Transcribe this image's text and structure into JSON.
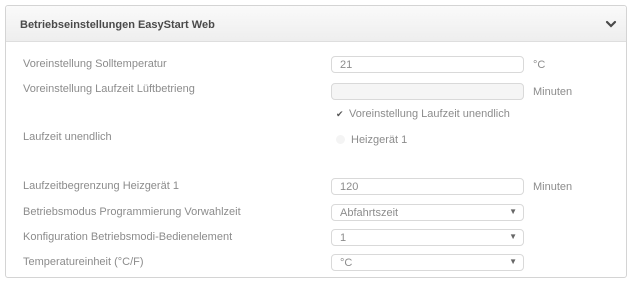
{
  "panel": {
    "title": "Betriebseinstellungen EasyStart Web",
    "collapse_icon": "chevron-down-icon"
  },
  "rows": {
    "soll_temp": {
      "label": "Voreinstellung Solltemperatur",
      "value": "21",
      "unit": "°C"
    },
    "laufzeit_lueftung": {
      "label": "Voreinstellung Laufzeit Lüftbetrieng",
      "value": "",
      "unit": "Minuten"
    },
    "laufzeit_unendlich": {
      "label": "Laufzeit unendlich",
      "checkbox_label": "Voreinstellung Laufzeit unendlich",
      "checked": true,
      "device_label": "Heizgerät 1"
    },
    "laufzeitbegrenzung": {
      "label": "Laufzeitbegrenzung Heizgerät 1",
      "value": "120",
      "unit": "Minuten"
    },
    "betriebsmodus": {
      "label": "Betriebsmodus Programmierung Vorwahlzeit",
      "value": "Abfahrtszeit"
    },
    "konfiguration": {
      "label": "Konfiguration Betriebsmodi-Bedienelement",
      "value": "1"
    },
    "temperatureinheit": {
      "label": "Temperatureinheit (°C/F)",
      "value": "°C"
    }
  }
}
